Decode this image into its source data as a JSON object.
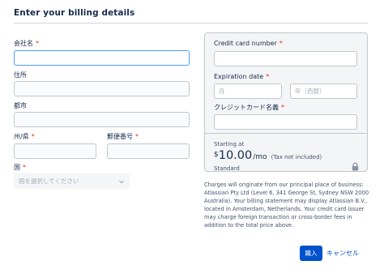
{
  "header": {
    "title": "Enter your billing details"
  },
  "address": {
    "company_label": "会社名",
    "address_label": "住所",
    "city_label": "都市",
    "state_label": "州/県",
    "postal_label": "郵便番号",
    "country_label": "国",
    "country_placeholder": "国を選択してください",
    "required_mark": "*"
  },
  "card": {
    "number_label": "Credit card number",
    "expiry_label": "Expiration date",
    "month_placeholder": "月",
    "year_placeholder": "年（西暦）",
    "name_label": "クレジットカード名義",
    "required_mark": "*"
  },
  "pricing": {
    "starting_text": "Starting at",
    "currency": "$",
    "amount": "10.00",
    "period": "/mo",
    "tax_note": "(Tax not included)",
    "plan": "Standard"
  },
  "disclaimer": "Charges will originate from our principal place of business: Atlassian Pty Ltd (Level 6, 341 George St, Sydney NSW 2000 Australia). Your billing statement may display Atlassian B.V., located in Amsterdam, Netherlands. Your credit card issuer may charge foreign transaction or cross-border fees in addition to the total price above.",
  "actions": {
    "buy_label": "購入",
    "cancel_label": "キャンセル"
  },
  "colors": {
    "primary": "#0052cc",
    "required": "#de350b",
    "focus": "#4c9aff",
    "text": "#172b4d"
  }
}
